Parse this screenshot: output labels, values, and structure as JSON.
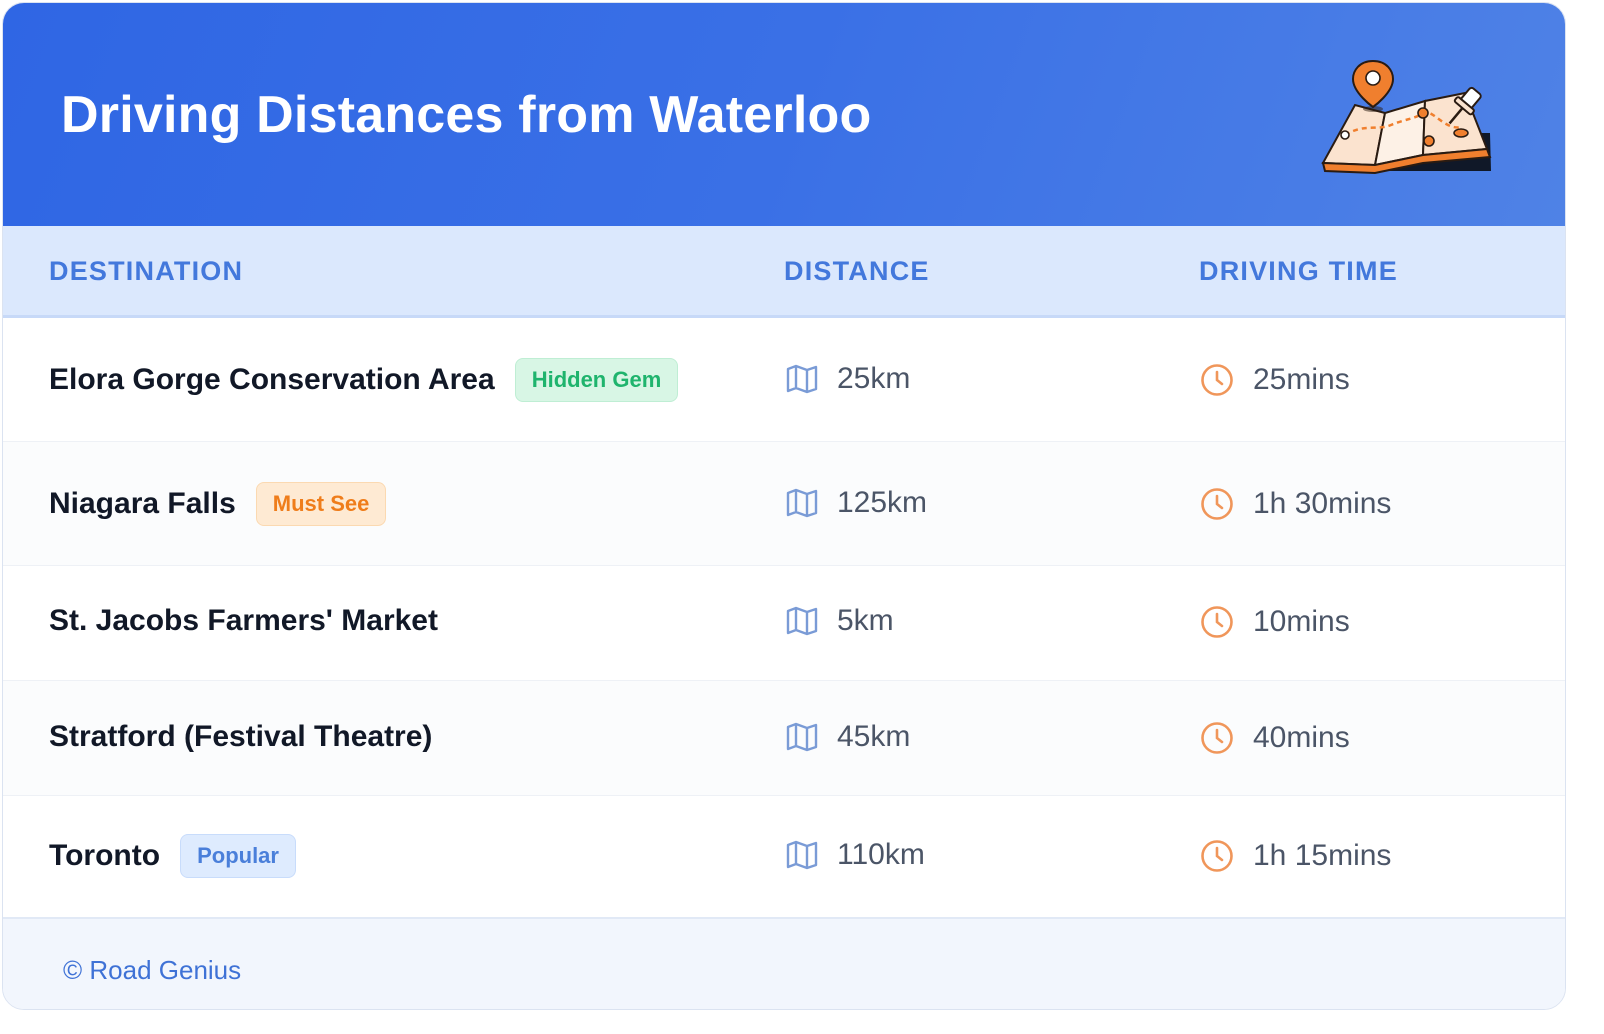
{
  "header": {
    "title": "Driving Distances from Waterloo",
    "illustration_icon": "map-with-pins"
  },
  "table": {
    "columns": [
      "DESTINATION",
      "DISTANCE",
      "DRIVING TIME"
    ],
    "rows": [
      {
        "destination": "Elora Gorge Conservation Area",
        "badge": "Hidden Gem",
        "badge_color": "#1fb46d",
        "distance": "25km",
        "time": "25mins"
      },
      {
        "destination": "Niagara Falls",
        "badge": "Must See",
        "badge_color": "#ef7d1b",
        "distance": "125km",
        "time": "1h 30mins"
      },
      {
        "destination": "St. Jacobs Farmers' Market",
        "badge": "",
        "distance": "5km",
        "time": "10mins"
      },
      {
        "destination": "Stratford (Festival Theatre)",
        "badge": "",
        "distance": "45km",
        "time": "40mins"
      },
      {
        "destination": "Toronto",
        "badge": "Popular",
        "badge_color": "#4a7fda",
        "distance": "110km",
        "time": "1h 15mins"
      }
    ]
  },
  "footer": {
    "text": "© Road Genius"
  },
  "colors": {
    "header_blue": "#2f66e4",
    "accent_blue": "#4378dc",
    "clock_orange": "#f0965a",
    "map_icon_blue": "#7a9bd6"
  }
}
